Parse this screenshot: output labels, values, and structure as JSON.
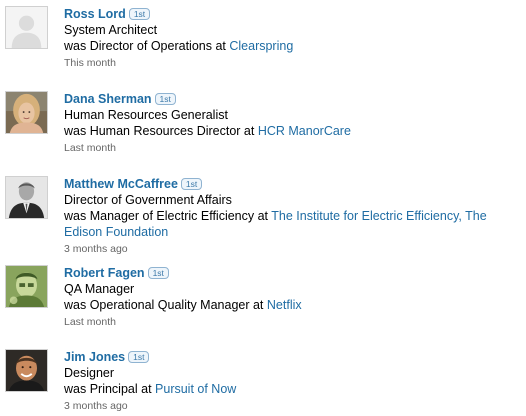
{
  "entries": [
    {
      "name": "Ross Lord",
      "degree": "1st",
      "title": "System Architect",
      "past_prefix": "was Director of Operations at",
      "company": "Clearspring",
      "time": "This month",
      "avatar": "ghost-avatar-icon"
    },
    {
      "name": "Dana Sherman",
      "degree": "1st",
      "title": "Human Resources Generalist",
      "past_prefix": "was Human Resources Director at",
      "company": "HCR ManorCare",
      "time": "Last month",
      "avatar": "profile-photo"
    },
    {
      "name": "Matthew McCaffree",
      "degree": "1st",
      "title": "Director of Government Affairs",
      "past_prefix": "was Manager of Electric Efficiency at",
      "company": "The Institute for Electric Efficiency, The Edison Foundation",
      "time": "3 months ago",
      "avatar": "profile-photo"
    },
    {
      "name": "Robert Fagen",
      "degree": "1st",
      "title": "QA Manager",
      "past_prefix": "was Operational Quality Manager at",
      "company": "Netflix",
      "time": "Last month",
      "avatar": "profile-photo"
    },
    {
      "name": "Jim Jones",
      "degree": "1st",
      "title": "Designer",
      "past_prefix": "was Principal at",
      "company": "Pursuit of Now",
      "time": "3 months ago",
      "avatar": "profile-photo"
    }
  ],
  "colors": {
    "link": "#1f6ca3",
    "timestamp": "#666666",
    "badge_border": "#8fb3d1"
  }
}
